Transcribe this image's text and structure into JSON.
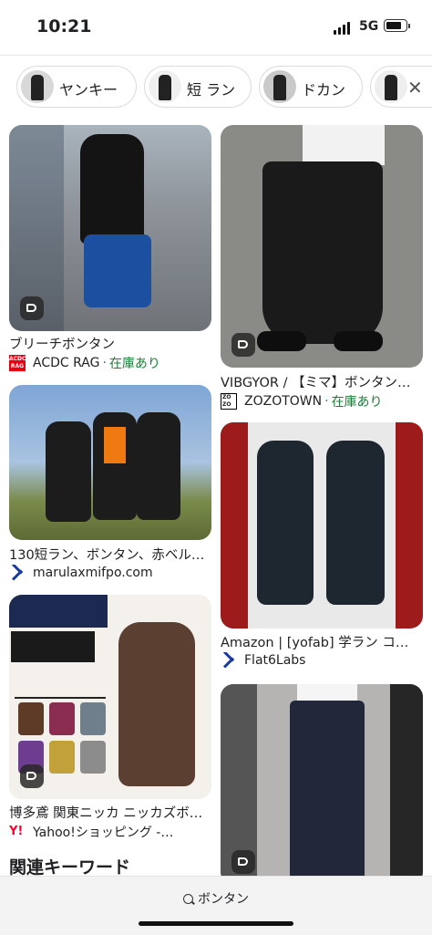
{
  "status": {
    "time": "10:21",
    "network": "5G"
  },
  "chips": [
    {
      "label": "ヤンキー"
    },
    {
      "label": "短 ラン"
    },
    {
      "label": "ドカン"
    }
  ],
  "left_cards": [
    {
      "title": "ブリーチボンタン",
      "source": "ACDC RAG",
      "stock": "在庫あり",
      "favicon": "acdc-icon",
      "image": "photo: model in black shirt and blue bleached wide pants on street"
    },
    {
      "title": "130短ラン、ボンタン、赤ベル…",
      "source": "marulaxmifpo.com",
      "stock": "",
      "favicon": "flat-icon",
      "image": "photo: three young men in black uniforms with wide pants outdoors"
    },
    {
      "title": "博多鳶 関東ニッカ ニッカズボ…",
      "source": "Yahoo!ショッピング -…",
      "stock": "",
      "favicon": "yahoo-icon",
      "image": "photo: HAKATA TOBI 関東ニッカ workwear catalog with colored pants"
    }
  ],
  "right_cards": [
    {
      "title": "VIBGYOR / 【ミマ】ボンタン…",
      "source": "ZOZOTOWN",
      "stock": "在庫あり",
      "favicon": "zozo-icon",
      "image": "photo: person in white shirt and black balloon pants on grey background"
    },
    {
      "title": "Amazon | [yofab] 学ラン コ…",
      "source": "Flat6Labs",
      "stock": "",
      "favicon": "flat-icon",
      "image": "photo: front and back view of man in school uniform with red Japanese banners"
    },
    {
      "title": "",
      "source": "",
      "stock": "",
      "favicon": "",
      "image": "photo: person in black wide denim trousers"
    }
  ],
  "related_heading": "関連キーワード",
  "search_query": "ボンタン",
  "colors": {
    "stock_green": "#188038",
    "acdc_red": "#e60012",
    "yahoo_red": "#ff0033"
  }
}
